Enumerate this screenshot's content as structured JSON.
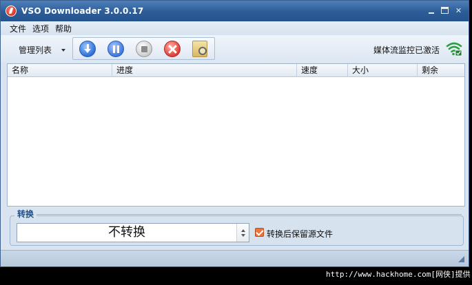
{
  "window": {
    "title": "VSO Downloader 3.0.0.17",
    "accent": "#2d5d98"
  },
  "menu": {
    "items": [
      "文件",
      "选项",
      "帮助"
    ]
  },
  "toolbar": {
    "manage_label": "管理列表",
    "buttons": [
      "download-icon",
      "pause-icon",
      "stop-icon",
      "cancel-icon",
      "folder-search-icon"
    ],
    "monitor_status": "媒体流监控已激活"
  },
  "list": {
    "columns": [
      "名称",
      "进度",
      "速度",
      "大小",
      "剩余"
    ],
    "rows": []
  },
  "convert": {
    "title": "转换",
    "selected": "不转换",
    "keep_source_label": "转换后保留源文件",
    "keep_source_checked": true,
    "check_color": "#e9743e"
  },
  "watermark": "http://www.hackhome.com[网侠]提供"
}
